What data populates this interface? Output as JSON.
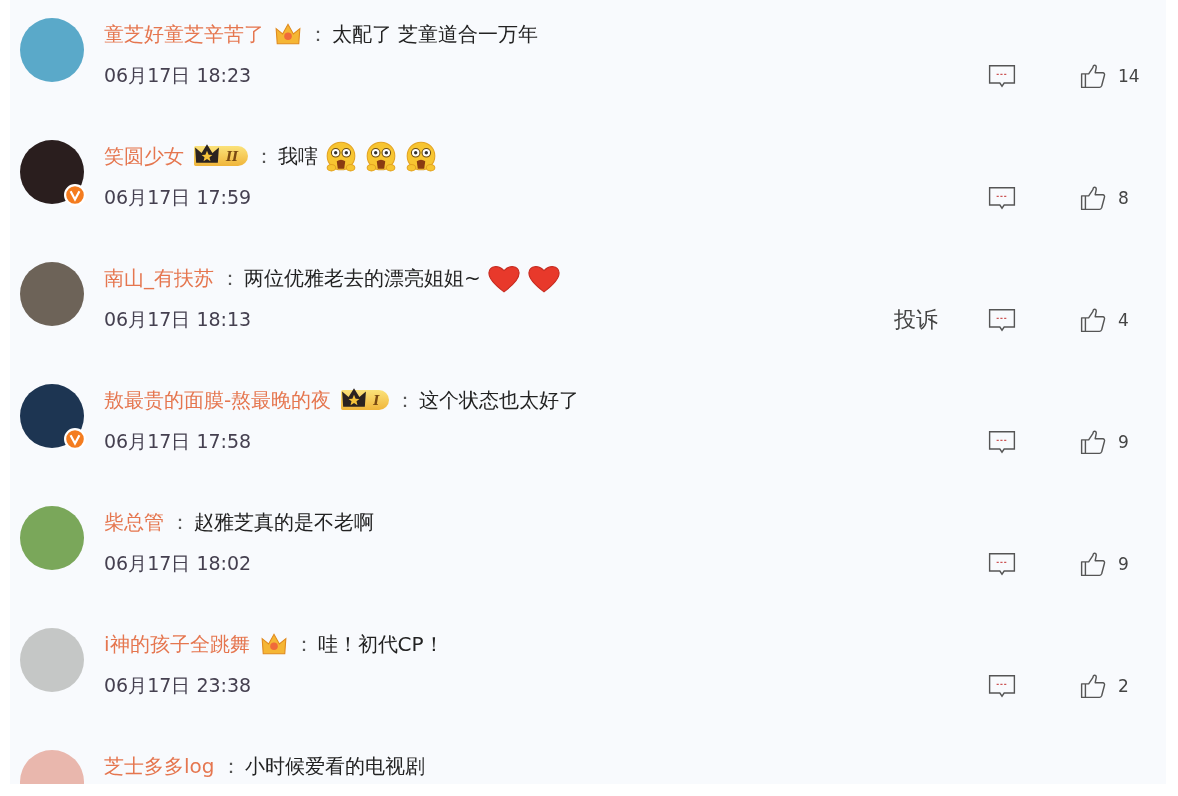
{
  "comments": [
    {
      "username": "童芝好童芝辛苦了",
      "badge": {
        "kind": "crown"
      },
      "verified": false,
      "separator": "：",
      "text": "太配了 芝童道合一万年",
      "time": "06月17日 18:23",
      "likes": "14"
    },
    {
      "username": "笑圆少女",
      "badge": {
        "kind": "vip",
        "label": "II"
      },
      "verified": true,
      "separator": "：",
      "text": "我嗐",
      "emojis": [
        {
          "kind": "shocked"
        },
        {
          "kind": "shocked"
        },
        {
          "kind": "shocked"
        }
      ],
      "time": "06月17日 17:59",
      "likes": "8"
    },
    {
      "username": "南山_有扶苏",
      "verified": false,
      "separator": "：",
      "text": "两位优雅老去的漂亮姐姐~",
      "emojis": [
        {
          "kind": "heart"
        },
        {
          "kind": "heart"
        }
      ],
      "time": "06月17日 18:13",
      "report_label": "投诉",
      "likes": "4"
    },
    {
      "username": "敖最贵的面膜-熬最晚的夜",
      "badge": {
        "kind": "vip",
        "label": "I"
      },
      "verified": true,
      "separator": "：",
      "text": "这个状态也太好了",
      "time": "06月17日 17:58",
      "likes": "9"
    },
    {
      "username": "柴总管",
      "verified": false,
      "separator": "：",
      "text": "赵雅芝真的是不老啊",
      "time": "06月17日 18:02",
      "likes": "9"
    },
    {
      "username": "i神的孩子全跳舞",
      "badge": {
        "kind": "crown"
      },
      "verified": false,
      "separator": "：",
      "text": "哇！初代CP！",
      "time": "06月17日 23:38",
      "likes": "2"
    },
    {
      "username": "芝士多多log",
      "verified": false,
      "separator": "：",
      "text": "小时候爱看的电视剧"
    }
  ]
}
